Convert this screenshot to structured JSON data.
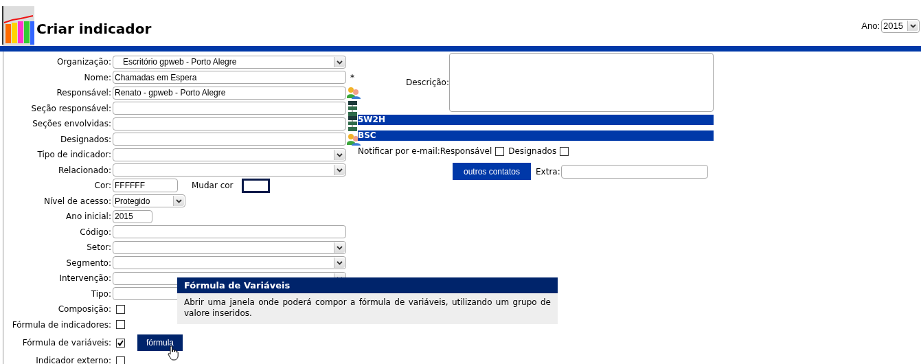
{
  "header": {
    "title": "Criar indicador",
    "year_label": "Ano:",
    "year_value": "2015"
  },
  "left_fields": [
    {
      "label": "Organização:",
      "kind": "select",
      "value": "Escritório gpweb - Porto Alegre"
    },
    {
      "label": "Nome:",
      "kind": "text",
      "value": "Chamadas em Espera",
      "required_mark": "*"
    },
    {
      "label": "Responsável:",
      "kind": "text",
      "value": "Renato - gpweb - Porto Alegre",
      "picker": {
        "kind": "people"
      }
    },
    {
      "label": "Seção responsável:",
      "kind": "text",
      "picker": {
        "kind": "org"
      }
    },
    {
      "label": "Seções envolvidas:",
      "kind": "text",
      "picker": {
        "kind": "org"
      }
    },
    {
      "label": "Designados:",
      "kind": "text",
      "picker": {
        "kind": "people"
      }
    },
    {
      "label": "Tipo de indicador:",
      "kind": "select"
    },
    {
      "label": "Relacionado:",
      "kind": "select"
    },
    {
      "label": "Cor:",
      "kind": "color",
      "value": "FFFFFF",
      "action": "Mudar cor"
    },
    {
      "label": "Nível de acesso:",
      "kind": "short_select",
      "value": "Protegido"
    },
    {
      "label": "Ano inicial:",
      "kind": "year",
      "value": "2015"
    },
    {
      "label": "Código:",
      "kind": "text"
    },
    {
      "label": "Setor:",
      "kind": "select"
    },
    {
      "label": "Segmento:",
      "kind": "select"
    },
    {
      "label": "Intervenção:",
      "kind": "select"
    },
    {
      "label": "Tipo:",
      "kind": "text"
    },
    {
      "label": "Composição:",
      "kind": "checkbox",
      "checked": false
    },
    {
      "label": "Fórmula de indicadores:",
      "kind": "checkbox",
      "checked": false
    },
    {
      "label": "Fórmula de variáveis:",
      "kind": "checkbox",
      "checked": true,
      "button": "fórmula"
    },
    {
      "label": "Indicador externo:",
      "kind": "checkbox",
      "checked": false
    }
  ],
  "right": {
    "description_label": "Descrição:",
    "section_bars": [
      "5W2H",
      "BSC"
    ],
    "notify_label": "Notificar por e-mail:",
    "notify_options": [
      {
        "label": "Responsável",
        "checked": false
      },
      {
        "label": "Designados",
        "checked": false
      }
    ],
    "contacts_button": "outros contatos",
    "extra_label": "Extra:"
  },
  "tooltip": {
    "title": "Fórmula de Variáveis",
    "body": "Abrir uma janela onde poderá compor a fórmula de variáveis, utilizando um grupo de valore inseridos."
  }
}
